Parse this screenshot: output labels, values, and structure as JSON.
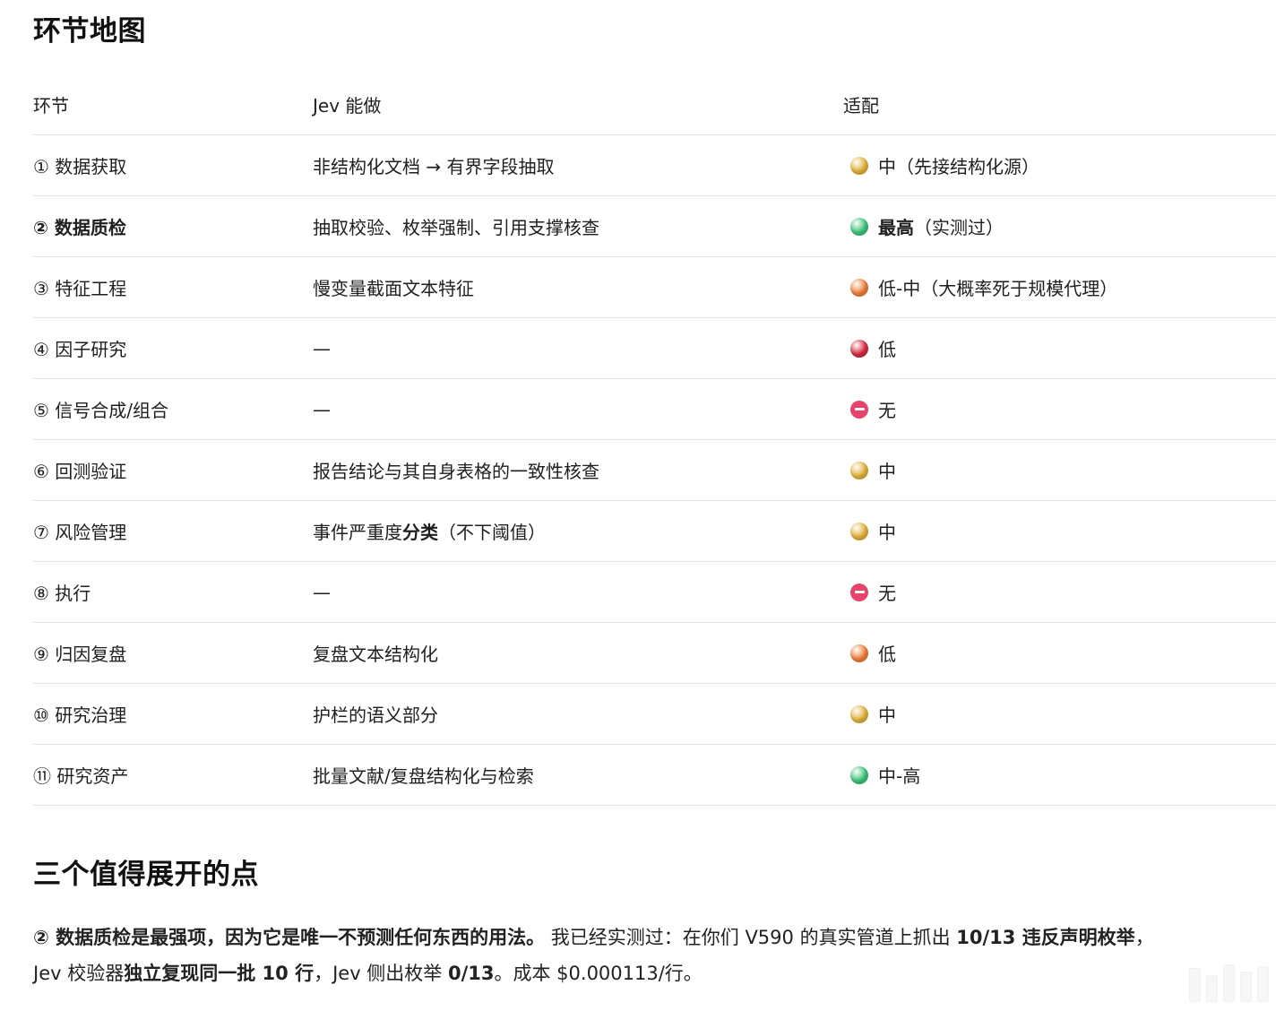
{
  "headings": {
    "map": "环节地图",
    "three_points": "三个值得展开的点"
  },
  "table": {
    "headers": [
      "环节",
      "Jev 能做",
      "适配"
    ],
    "rows": [
      {
        "stage": "① 数据获取",
        "can_do": "非结构化文档 → 有界字段抽取",
        "fit_bold": "",
        "fit": "中（先接结构化源）",
        "dot_color": "#e2b23a",
        "dot_type": "dot"
      },
      {
        "stage": "② 数据质检",
        "can_do": "抽取校验、枚举强制、引用支撑核查",
        "fit_bold": "最高",
        "fit": "（实测过）",
        "dot_color": "#3cc47a",
        "dot_type": "dot"
      },
      {
        "stage": "③ 特征工程",
        "can_do": "慢变量截面文本特征",
        "fit_bold": "",
        "fit": "低-中（大概率死于规模代理）",
        "dot_color": "#f07d3a",
        "dot_type": "dot"
      },
      {
        "stage": "④ 因子研究",
        "can_do": "—",
        "fit_bold": "",
        "fit": "低",
        "dot_color": "#d6293f",
        "dot_type": "dot"
      },
      {
        "stage": "⑤ 信号合成/组合",
        "can_do": "—",
        "fit_bold": "",
        "fit": "无",
        "dot_color": "#e8436a",
        "dot_type": "nodot"
      },
      {
        "stage": "⑥ 回测验证",
        "can_do": "报告结论与其自身表格的一致性核查",
        "fit_bold": "",
        "fit": "中",
        "dot_color": "#e2b23a",
        "dot_type": "dot"
      },
      {
        "stage": "⑦ 风险管理",
        "can_do_pre": "事件严重度",
        "can_do_bold": "分类",
        "can_do_post": "（不下阈值）",
        "fit_bold": "",
        "fit": "中",
        "dot_color": "#e2b23a",
        "dot_type": "dot"
      },
      {
        "stage": "⑧ 执行",
        "can_do": "—",
        "fit_bold": "",
        "fit": "无",
        "dot_color": "#e8436a",
        "dot_type": "nodot"
      },
      {
        "stage": "⑨ 归因复盘",
        "can_do": "复盘文本结构化",
        "fit_bold": "",
        "fit": "低",
        "dot_color": "#f07d3a",
        "dot_type": "dot"
      },
      {
        "stage": "⑩ 研究治理",
        "can_do": "护栏的语义部分",
        "fit_bold": "",
        "fit": "中",
        "dot_color": "#e2b23a",
        "dot_type": "dot"
      },
      {
        "stage": "⑪ 研究资产",
        "can_do": "批量文献/复盘结构化与检索",
        "fit_bold": "",
        "fit": "中-高",
        "dot_color": "#3cc47a",
        "dot_type": "dot"
      }
    ]
  },
  "paragraph": {
    "lead_bold": "② 数据质检是最强项，因为它是唯一不预测任何东西的用法。",
    "text1": " 我已经实测过：在你们 V590 的真实管道上抓出 ",
    "bold1": "10/13 违反声明枚举",
    "text2": "，",
    "text3": "Jev 校验器",
    "bold2": "独立复现同一批 10 行",
    "text4": "，Jev 侧出枚举 ",
    "bold3": "0/13",
    "text5": "。成本 $0.000113/行。"
  }
}
